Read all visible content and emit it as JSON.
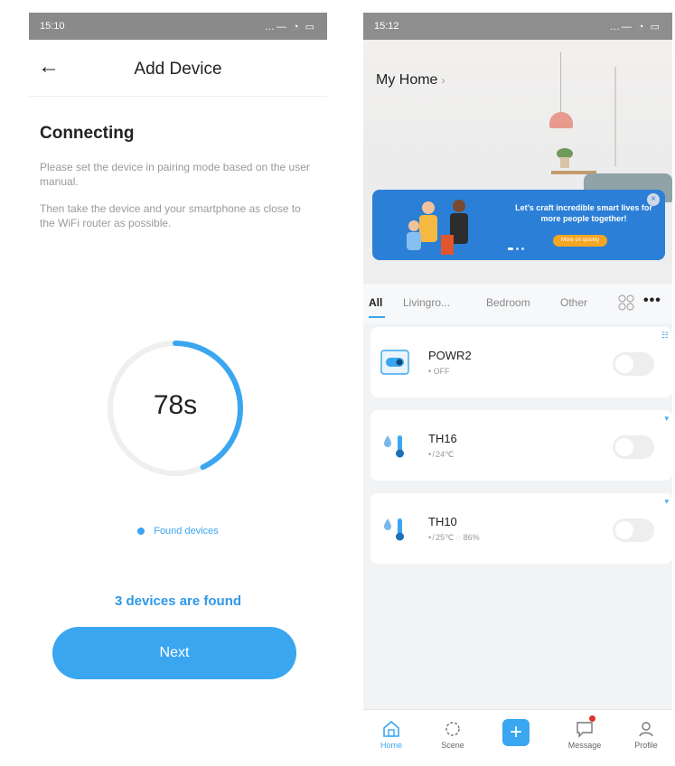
{
  "left": {
    "status": {
      "time": "15:10",
      "right": "…— ◔ ▭"
    },
    "header": {
      "back_icon": "arrow-left-icon",
      "title": "Add Device"
    },
    "heading": "Connecting",
    "instruction_1": "Please set the device in pairing mode based on the user manual.",
    "instruction_2": "Then take the device and your smartphone as close to the WiFi router as possible.",
    "countdown": {
      "label": "78s",
      "progress": 0.43,
      "color": "#3aa6f0"
    },
    "found_label": "Found devices",
    "devices_found": "3 devices are found",
    "next_button": "Next"
  },
  "right": {
    "status": {
      "time": "15:12",
      "right": "…— ◔ ▭"
    },
    "home_title": "My Home",
    "home_chevron": "›",
    "banner": {
      "line": "Let's craft incredible smart lives for more people together!",
      "cta": "More on quickly",
      "close": "×"
    },
    "tabs": [
      "All",
      "Livingro...",
      "Bedroom",
      "Other"
    ],
    "devices": [
      {
        "name": "POWR2",
        "status": "• OFF",
        "icon": "power-switch-icon",
        "corner": "☷"
      },
      {
        "name": "TH16",
        "status": "• ̸ 24℃",
        "icon": "temp-humidity-icon",
        "corner": "▾"
      },
      {
        "name": "TH10",
        "status": "• ̸ 25℃   ◌ 86%",
        "icon": "temp-humidity-icon",
        "corner": "▾"
      }
    ],
    "tabbar": {
      "home": "Home",
      "scene": "Scene",
      "message": "Message",
      "profile": "Profile"
    },
    "accent": "#3aa6f0"
  }
}
